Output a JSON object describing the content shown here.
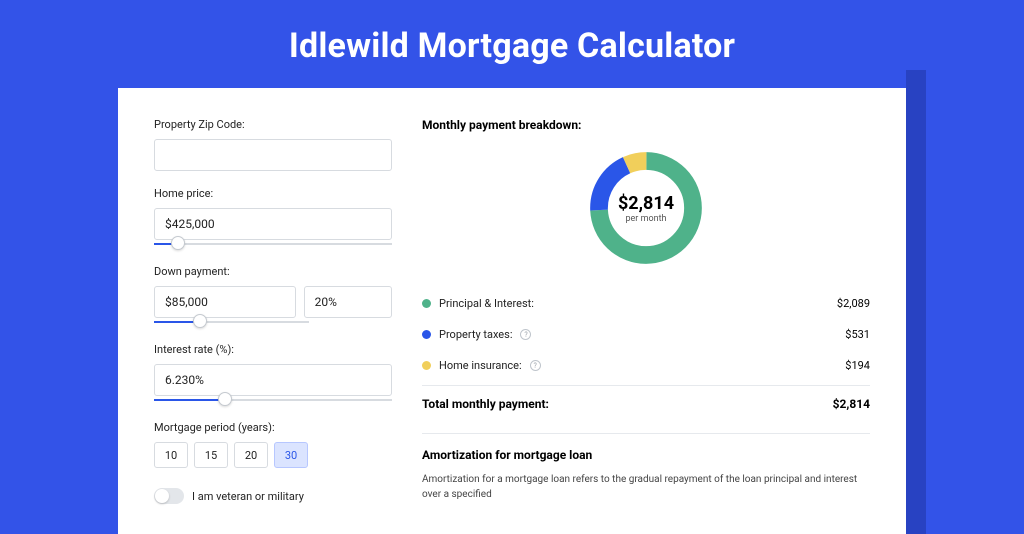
{
  "title": "Idlewild Mortgage Calculator",
  "form": {
    "zip_label": "Property Zip Code:",
    "zip_value": "",
    "home_price_label": "Home price:",
    "home_price_value": "$425,000",
    "home_price_slider_pct": 10,
    "down_payment_label": "Down payment:",
    "down_payment_value": "$85,000",
    "down_payment_pct_value": "20%",
    "down_payment_slider_pct": 20,
    "interest_label": "Interest rate (%):",
    "interest_value": "6.230%",
    "interest_slider_pct": 30,
    "period_label": "Mortgage period (years):",
    "periods": [
      "10",
      "15",
      "20",
      "30"
    ],
    "period_active_index": 3,
    "veteran_label": "I am veteran or military",
    "veteran_on": false
  },
  "breakdown": {
    "title": "Monthly payment breakdown:",
    "center_amount": "$2,814",
    "center_per": "per month",
    "items": [
      {
        "label": "Principal & Interest:",
        "value": "$2,089",
        "color": "#4fb28a",
        "info": false
      },
      {
        "label": "Property taxes:",
        "value": "$531",
        "color": "#2a56e8",
        "info": true
      },
      {
        "label": "Home insurance:",
        "value": "$194",
        "color": "#f1cf5b",
        "info": true
      }
    ],
    "total_label": "Total monthly payment:",
    "total_value": "$2,814"
  },
  "chart_data": {
    "type": "pie",
    "title": "Monthly payment breakdown",
    "categories": [
      "Principal & Interest",
      "Property taxes",
      "Home insurance"
    ],
    "values": [
      2089,
      531,
      194
    ],
    "colors": [
      "#4fb28a",
      "#2a56e8",
      "#f1cf5b"
    ],
    "center_label": "$2,814 per month"
  },
  "amortization": {
    "title": "Amortization for mortgage loan",
    "text": "Amortization for a mortgage loan refers to the gradual repayment of the loan principal and interest over a specified"
  }
}
